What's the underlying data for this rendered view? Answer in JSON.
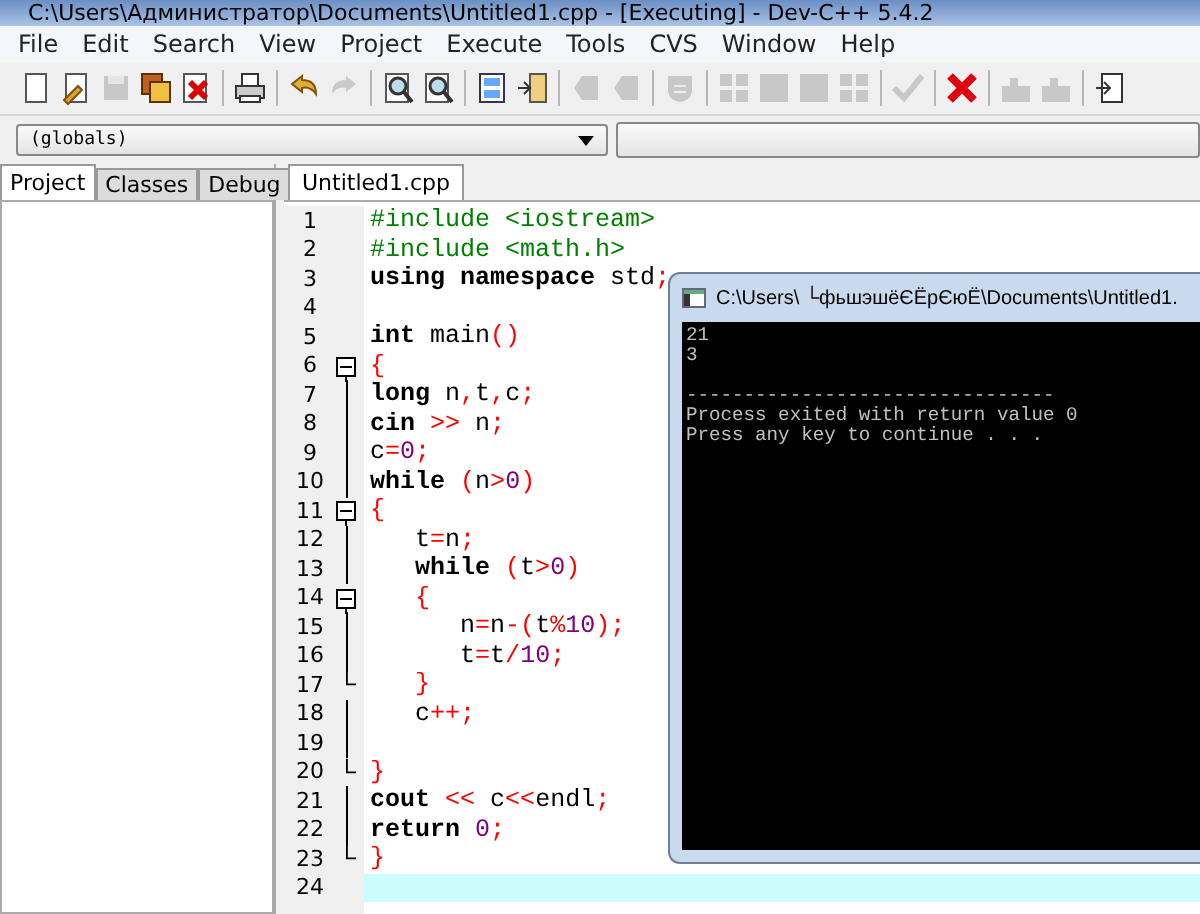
{
  "window": {
    "title": "C:\\Users\\Администратор\\Documents\\Untitled1.cpp - [Executing] - Dev-C++ 5.4.2"
  },
  "menu": [
    "File",
    "Edit",
    "Search",
    "View",
    "Project",
    "Execute",
    "Tools",
    "CVS",
    "Window",
    "Help"
  ],
  "toolbar": [
    {
      "kind": "page",
      "disabled": false
    },
    {
      "kind": "pencil-page",
      "disabled": false
    },
    {
      "kind": "disk",
      "disabled": true
    },
    {
      "kind": "disks",
      "disabled": false
    },
    {
      "kind": "page-x",
      "disabled": false
    },
    {
      "kind": "sep"
    },
    {
      "kind": "printer",
      "disabled": false
    },
    {
      "kind": "sep"
    },
    {
      "kind": "undo",
      "disabled": false
    },
    {
      "kind": "redo",
      "disabled": true
    },
    {
      "kind": "sep"
    },
    {
      "kind": "magnifier",
      "disabled": false
    },
    {
      "kind": "magnifier",
      "disabled": false
    },
    {
      "kind": "sep"
    },
    {
      "kind": "panels",
      "disabled": false
    },
    {
      "kind": "panel-arrow",
      "disabled": false
    },
    {
      "kind": "sep"
    },
    {
      "kind": "tag",
      "disabled": true
    },
    {
      "kind": "tag",
      "disabled": true
    },
    {
      "kind": "sep"
    },
    {
      "kind": "shield",
      "disabled": true
    },
    {
      "kind": "sep"
    },
    {
      "kind": "grid",
      "disabled": true
    },
    {
      "kind": "square",
      "disabled": true
    },
    {
      "kind": "square",
      "disabled": true
    },
    {
      "kind": "grid",
      "disabled": true
    },
    {
      "kind": "sep"
    },
    {
      "kind": "check",
      "disabled": true
    },
    {
      "kind": "sep"
    },
    {
      "kind": "cross",
      "disabled": false
    },
    {
      "kind": "sep"
    },
    {
      "kind": "blocks",
      "disabled": true
    },
    {
      "kind": "blocks",
      "disabled": true
    },
    {
      "kind": "sep"
    },
    {
      "kind": "page-arrow",
      "disabled": false
    }
  ],
  "scope_combo": {
    "value": "(globals)"
  },
  "side_tabs": [
    {
      "label": "Project",
      "selected": true
    },
    {
      "label": "Classes",
      "selected": false
    },
    {
      "label": "Debug",
      "selected": false
    }
  ],
  "editor_tabs": [
    {
      "label": "Untitled1.cpp",
      "selected": true
    }
  ],
  "code_lines": [
    {
      "number": "1",
      "kind": "plain",
      "current": false,
      "tokens": [
        {
          "kind": "pre",
          "text": "#include <iostream>"
        }
      ]
    },
    {
      "number": "2",
      "kind": "plain",
      "current": false,
      "tokens": [
        {
          "kind": "pre",
          "text": "#include <math.h>"
        }
      ]
    },
    {
      "number": "3",
      "kind": "plain",
      "current": false,
      "tokens": [
        {
          "kind": "kw",
          "text": "using namespace"
        },
        {
          "kind": "id",
          "text": " std"
        },
        {
          "kind": "sym",
          "text": ";"
        }
      ]
    },
    {
      "number": "4",
      "kind": "plain",
      "current": false
    },
    {
      "number": "5",
      "kind": "plain",
      "current": false,
      "tokens": [
        {
          "kind": "kw",
          "text": "int"
        },
        {
          "kind": "id",
          "text": " main"
        },
        {
          "kind": "sym",
          "text": "()"
        }
      ]
    },
    {
      "number": "6",
      "kind": "fold-start",
      "current": false,
      "tokens": [
        {
          "kind": "sym",
          "text": "{"
        }
      ]
    },
    {
      "number": "7",
      "kind": "fold-body",
      "current": false,
      "tokens": [
        {
          "kind": "kw",
          "text": "long"
        },
        {
          "kind": "id",
          "text": " n"
        },
        {
          "kind": "sym",
          "text": ","
        },
        {
          "kind": "id",
          "text": "t"
        },
        {
          "kind": "sym",
          "text": ","
        },
        {
          "kind": "id",
          "text": "c"
        },
        {
          "kind": "sym",
          "text": ";"
        }
      ]
    },
    {
      "number": "8",
      "kind": "fold-body",
      "current": false,
      "tokens": [
        {
          "kind": "kw",
          "text": "cin "
        },
        {
          "kind": "sym",
          "text": ">>"
        },
        {
          "kind": "id",
          "text": " n"
        },
        {
          "kind": "sym",
          "text": ";"
        }
      ]
    },
    {
      "number": "9",
      "kind": "fold-body",
      "current": false,
      "tokens": [
        {
          "kind": "id",
          "text": "c"
        },
        {
          "kind": "sym",
          "text": "="
        },
        {
          "kind": "num",
          "text": "0"
        },
        {
          "kind": "sym",
          "text": ";"
        }
      ]
    },
    {
      "number": "10",
      "kind": "fold-body",
      "current": false,
      "tokens": [
        {
          "kind": "kw",
          "text": "while "
        },
        {
          "kind": "sym",
          "text": "("
        },
        {
          "kind": "id",
          "text": "n"
        },
        {
          "kind": "sym",
          "text": ">"
        },
        {
          "kind": "num",
          "text": "0"
        },
        {
          "kind": "sym",
          "text": ")"
        }
      ]
    },
    {
      "number": "11",
      "kind": "fold-start",
      "current": false,
      "tokens": [
        {
          "kind": "sym",
          "text": "{"
        }
      ]
    },
    {
      "number": "12",
      "kind": "fold-body",
      "current": false,
      "tokens": [
        {
          "kind": "id",
          "text": "   t"
        },
        {
          "kind": "sym",
          "text": "="
        },
        {
          "kind": "id",
          "text": "n"
        },
        {
          "kind": "sym",
          "text": ";"
        }
      ]
    },
    {
      "number": "13",
      "kind": "fold-body",
      "current": false,
      "tokens": [
        {
          "kind": "kw",
          "text": "   while "
        },
        {
          "kind": "sym",
          "text": "("
        },
        {
          "kind": "id",
          "text": "t"
        },
        {
          "kind": "sym",
          "text": ">"
        },
        {
          "kind": "num",
          "text": "0"
        },
        {
          "kind": "sym",
          "text": ")"
        }
      ]
    },
    {
      "number": "14",
      "kind": "fold-start",
      "current": false,
      "tokens": [
        {
          "kind": "sym",
          "text": "   {"
        }
      ]
    },
    {
      "number": "15",
      "kind": "fold-body",
      "current": false,
      "tokens": [
        {
          "kind": "id",
          "text": "      n"
        },
        {
          "kind": "sym",
          "text": "="
        },
        {
          "kind": "id",
          "text": "n"
        },
        {
          "kind": "sym",
          "text": "-("
        },
        {
          "kind": "id",
          "text": "t"
        },
        {
          "kind": "sym",
          "text": "%"
        },
        {
          "kind": "num",
          "text": "10"
        },
        {
          "kind": "sym",
          "text": ");"
        }
      ]
    },
    {
      "number": "16",
      "kind": "fold-body",
      "current": false,
      "tokens": [
        {
          "kind": "id",
          "text": "      t"
        },
        {
          "kind": "sym",
          "text": "="
        },
        {
          "kind": "id",
          "text": "t"
        },
        {
          "kind": "sym",
          "text": "/"
        },
        {
          "kind": "num",
          "text": "10"
        },
        {
          "kind": "sym",
          "text": ";"
        }
      ]
    },
    {
      "number": "17",
      "kind": "fold-end",
      "current": false,
      "tokens": [
        {
          "kind": "sym",
          "text": "   }"
        }
      ]
    },
    {
      "number": "18",
      "kind": "fold-body",
      "current": false,
      "tokens": [
        {
          "kind": "id",
          "text": "   c"
        },
        {
          "kind": "sym",
          "text": "++;"
        }
      ]
    },
    {
      "number": "19",
      "kind": "fold-body",
      "current": false
    },
    {
      "number": "20",
      "kind": "fold-end",
      "current": false,
      "tokens": [
        {
          "kind": "sym",
          "text": "}"
        }
      ]
    },
    {
      "number": "21",
      "kind": "fold-body",
      "current": false,
      "tokens": [
        {
          "kind": "kw",
          "text": "cout "
        },
        {
          "kind": "sym",
          "text": "<<"
        },
        {
          "kind": "id",
          "text": " c"
        },
        {
          "kind": "sym",
          "text": "<<"
        },
        {
          "kind": "id",
          "text": "endl"
        },
        {
          "kind": "sym",
          "text": ";"
        }
      ]
    },
    {
      "number": "22",
      "kind": "fold-body",
      "current": false,
      "tokens": [
        {
          "kind": "kw",
          "text": "return "
        },
        {
          "kind": "num",
          "text": "0"
        },
        {
          "kind": "sym",
          "text": ";"
        }
      ]
    },
    {
      "number": "23",
      "kind": "fold-end",
      "current": false,
      "tokens": [
        {
          "kind": "sym",
          "text": "}"
        }
      ]
    },
    {
      "number": "24",
      "kind": "plain",
      "current": true
    }
  ],
  "console": {
    "title": "C:\\Users\\ └фьшэшёЄЁрЄюЁ\\Documents\\Untitled1.",
    "output": [
      "21",
      "3"
    ],
    "separator": "--------------------------------",
    "messages": [
      "Process exited with return value 0",
      "Press any key to continue . . ."
    ]
  }
}
